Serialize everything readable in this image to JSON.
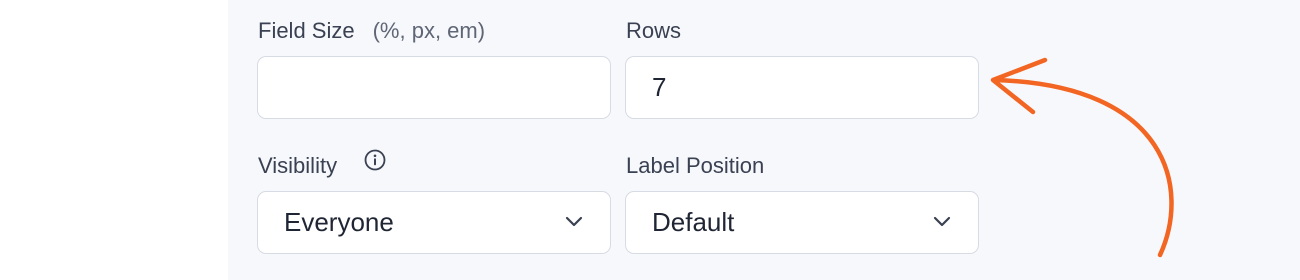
{
  "form": {
    "field_size": {
      "label": "Field Size",
      "hint": "(%, px, em)",
      "value": "",
      "placeholder": ""
    },
    "rows": {
      "label": "Rows",
      "value": "7"
    },
    "visibility": {
      "label": "Visibility",
      "info_icon": "info-icon",
      "selected": "Everyone"
    },
    "label_position": {
      "label": "Label Position",
      "selected": "Default"
    }
  },
  "annotation": {
    "icon": "curved-arrow-icon",
    "color": "#f26522"
  },
  "colors": {
    "panel_background": "#f7f8fb",
    "field_border": "#d7dbe3",
    "text": "#2a3140"
  }
}
